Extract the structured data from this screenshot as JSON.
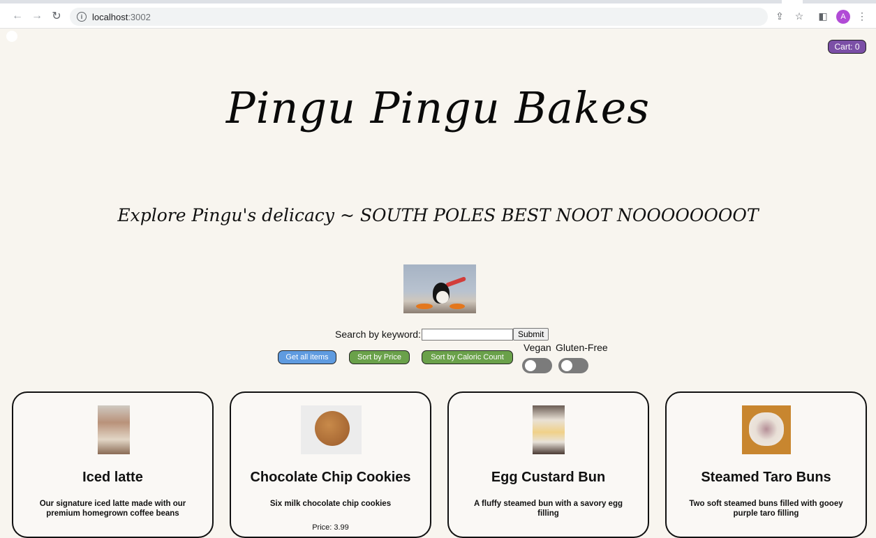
{
  "browser": {
    "url_host": "localhost",
    "url_port": ":3002",
    "avatar_letter": "A"
  },
  "header": {
    "cart_label": "Cart: 0",
    "title": "Pingu Pingu Bakes",
    "subtitle": "Explore Pingu's delicacy ~ SOUTH POLES BEST NOOT NOOOOOOOOT"
  },
  "search": {
    "label": "Search by keyword:",
    "value": "",
    "submit_label": "Submit"
  },
  "controls": {
    "get_all_label": "Get all items",
    "sort_price_label": "Sort by Price",
    "sort_calorie_label": "Sort by Caloric Count",
    "vegan_label": "Vegan",
    "gluten_free_label": "Gluten-Free",
    "vegan_on": false,
    "gluten_free_on": false
  },
  "products": [
    {
      "name": "Iced latte",
      "description": "Our signature iced latte made with our premium homegrown coffee beans",
      "image": "iced-latte-photo"
    },
    {
      "name": "Chocolate Chip Cookies",
      "description": "Six milk chocolate chip cookies",
      "price": "Price: 3.99",
      "image": "cookie-photo"
    },
    {
      "name": "Egg Custard Bun",
      "description": "A fluffy steamed bun with a savory egg filling",
      "image": "custard-bun-photo"
    },
    {
      "name": "Steamed Taro Buns",
      "description": "Two soft steamed buns filled with gooey purple taro filling",
      "image": "taro-bun-photo"
    }
  ],
  "colors": {
    "background": "#f8f5ef",
    "cart_purple": "#7b4fa6",
    "button_blue": "#5f9be0",
    "button_green": "#6aa14a"
  }
}
